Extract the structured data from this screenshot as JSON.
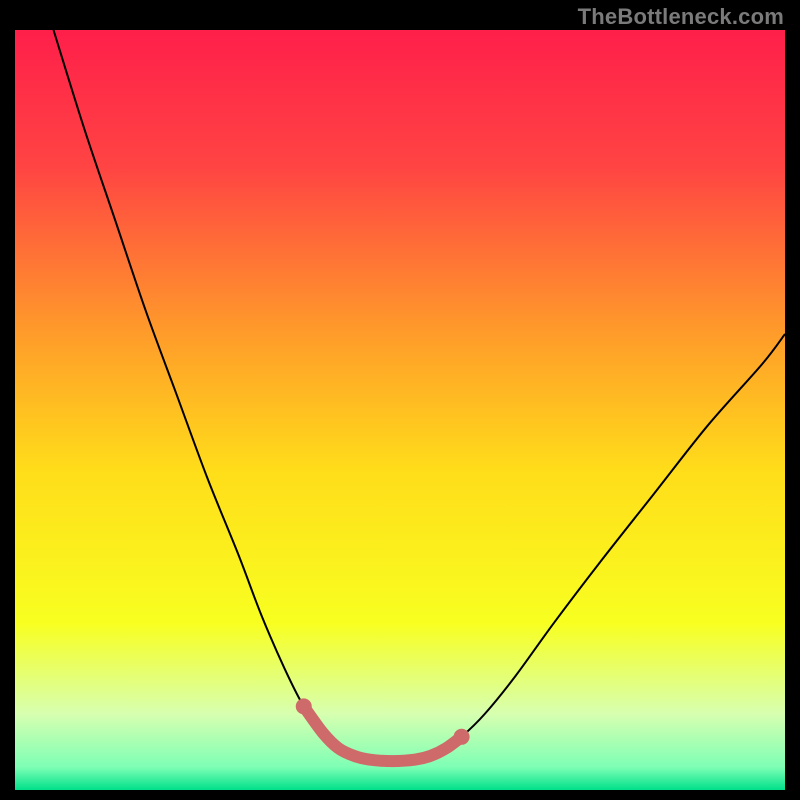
{
  "watermark": "TheBottleneck.com",
  "chart_data": {
    "type": "line",
    "title": "",
    "xlabel": "",
    "ylabel": "",
    "xlim": [
      0,
      100
    ],
    "ylim": [
      0,
      100
    ],
    "background_gradient": {
      "stops": [
        {
          "offset": 0.0,
          "color": "#ff1f4a"
        },
        {
          "offset": 0.18,
          "color": "#ff4443"
        },
        {
          "offset": 0.4,
          "color": "#ff9c2a"
        },
        {
          "offset": 0.58,
          "color": "#ffdd1a"
        },
        {
          "offset": 0.78,
          "color": "#f8ff20"
        },
        {
          "offset": 0.9,
          "color": "#d7ffb0"
        },
        {
          "offset": 0.97,
          "color": "#7dffb5"
        },
        {
          "offset": 1.0,
          "color": "#00e08a"
        }
      ]
    },
    "series": [
      {
        "name": "bottleneck-curve",
        "color": "#000000",
        "x": [
          5,
          9,
          13,
          17,
          21,
          25,
          29,
          32,
          35,
          37.5,
          40,
          42,
          44,
          46,
          52,
          54,
          56,
          58,
          61,
          65,
          70,
          76,
          83,
          90,
          97,
          100
        ],
        "y": [
          100,
          87,
          75,
          63,
          52,
          41,
          31,
          23,
          16,
          11,
          7.5,
          5.5,
          4.5,
          4,
          4,
          4.5,
          5.5,
          7,
          10,
          15,
          22,
          30,
          39,
          48,
          56,
          60
        ]
      },
      {
        "name": "highlight-band",
        "color": "#cf6a6a",
        "stroke_width": 12,
        "linecap": "round",
        "x": [
          37.5,
          40,
          42,
          44,
          46,
          49,
          52,
          54,
          56,
          58
        ],
        "y": [
          11,
          7.5,
          5.5,
          4.5,
          4,
          3.8,
          4,
          4.5,
          5.5,
          7
        ]
      }
    ]
  }
}
